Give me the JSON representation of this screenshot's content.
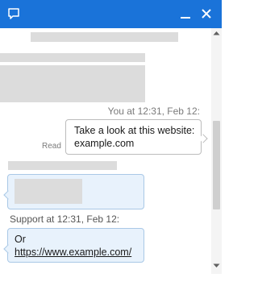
{
  "colors": {
    "accent": "#1a73d9",
    "sent_bubble_bg": "#ffffff",
    "received_bubble_bg": "#e8f2fc"
  },
  "titlebar": {
    "app_icon": "chat-bubble-icon",
    "minimize_icon": "minimize-icon",
    "close_icon": "close-icon"
  },
  "messages": {
    "sent": {
      "meta": "You at 12:31, Feb 12:",
      "text": "Take a look at this website: example.com",
      "status": "Read"
    },
    "received": {
      "meta": "Support at 12:31, Feb 12:",
      "text_prefix": "Or",
      "link_text": "https://www.example.com/"
    }
  },
  "scrollbar": {
    "up_icon": "scroll-up-arrow-icon",
    "down_icon": "scroll-down-arrow-icon"
  }
}
